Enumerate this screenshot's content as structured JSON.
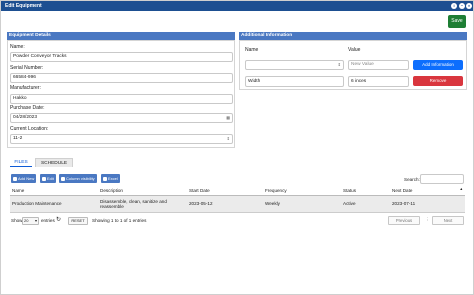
{
  "window": {
    "title": "Edit Equipment",
    "save_label": "Save"
  },
  "details": {
    "heading": "Equipment Details",
    "name_label": "Name:",
    "name_value": "Powder Conveyor Tracks",
    "serial_label": "Serial Number:",
    "serial_value": "66584-996",
    "manufacturer_label": "Manufacturer:",
    "manufacturer_value": "Hakko",
    "purchase_label": "Purchase Date:",
    "purchase_value": "04/28/2023",
    "location_label": "Current Location:",
    "location_value": "11-2"
  },
  "additional": {
    "heading": "Additional Information",
    "col_name": "Name",
    "col_value": "Value",
    "new_value_placeholder": "New Value",
    "add_label": "Add Information",
    "row_name": "Width",
    "row_value": "6 inces",
    "remove_label": "Remove"
  },
  "tabs": {
    "files": "FILES",
    "schedule": "SCHEDULE"
  },
  "toolbar": {
    "add_new": "Add New",
    "edit": "Edit",
    "column_visibility": "Column visibility",
    "excel": "Excel",
    "search_label": "Search:"
  },
  "table": {
    "columns": [
      "Name",
      "Description",
      "Start Date",
      "Frequency",
      "Status",
      "Next Date"
    ],
    "rows": [
      {
        "name": "Production Maintenance",
        "description": "Disassemble, clean, sanitize and reassemble",
        "start_date": "2023-05-12",
        "frequency": "Weekly",
        "status": "Active",
        "next_date": "2023-07-11"
      }
    ]
  },
  "footer": {
    "show_label": "Show",
    "show_value": "20",
    "entries_label": "entries",
    "reset_label": "RESET",
    "info": "Showing 1 to 1 of 1 entries",
    "previous": "Previous",
    "next": "Next"
  },
  "colors": {
    "titlebar": "#1d4f91",
    "panel_header": "#4a78c2",
    "save": "#1e7e34",
    "add": "#0d6efd",
    "remove": "#d9363e"
  }
}
